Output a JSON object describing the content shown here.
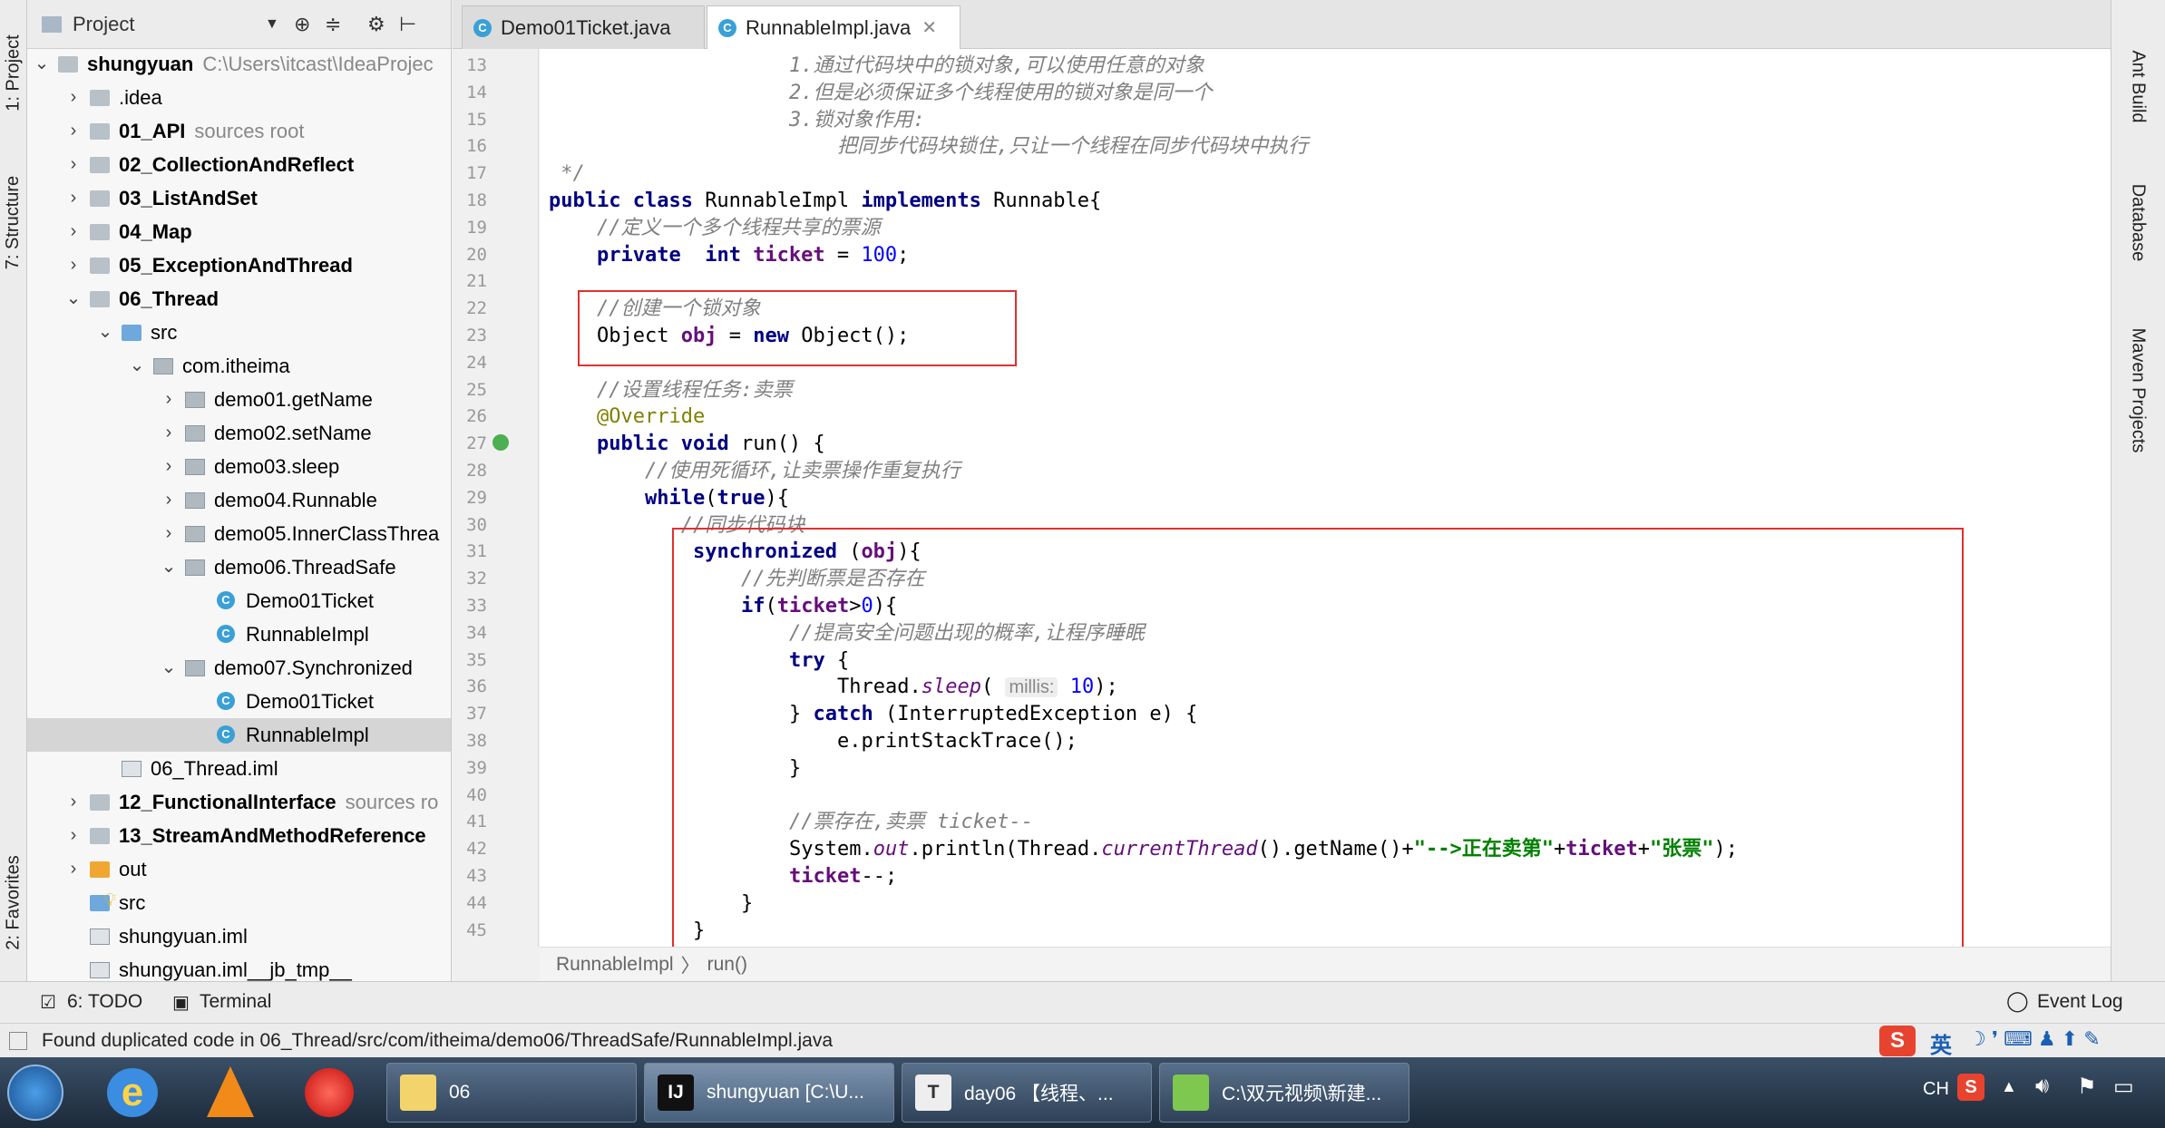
{
  "left_strip": {
    "project_tab": "1: Project",
    "structure_tab": "7: Structure",
    "favorites_tab": "2: Favorites"
  },
  "project_header": {
    "title": "Project"
  },
  "tree": [
    {
      "label": "shungyuan",
      "suffix": "C:\\Users\\itcast\\IdeaProjec",
      "depth": 0,
      "arrow": "v",
      "icon": "folder-grey",
      "bold": true
    },
    {
      "label": ".idea",
      "suffix": "",
      "depth": 1,
      "arrow": ">",
      "icon": "folder-grey",
      "bold": false
    },
    {
      "label": "01_API",
      "suffix": "sources root",
      "depth": 1,
      "arrow": ">",
      "icon": "folder-grey",
      "bold": true
    },
    {
      "label": "02_CollectionAndReflect",
      "suffix": "",
      "depth": 1,
      "arrow": ">",
      "icon": "folder-grey",
      "bold": true
    },
    {
      "label": "03_ListAndSet",
      "suffix": "",
      "depth": 1,
      "arrow": ">",
      "icon": "folder-grey",
      "bold": true
    },
    {
      "label": "04_Map",
      "suffix": "",
      "depth": 1,
      "arrow": ">",
      "icon": "folder-grey",
      "bold": true
    },
    {
      "label": "05_ExceptionAndThread",
      "suffix": "",
      "depth": 1,
      "arrow": ">",
      "icon": "folder-grey",
      "bold": true
    },
    {
      "label": "06_Thread",
      "suffix": "",
      "depth": 1,
      "arrow": "v",
      "icon": "folder-grey",
      "bold": true
    },
    {
      "label": "src",
      "suffix": "",
      "depth": 2,
      "arrow": "v",
      "icon": "folder-blue",
      "bold": false
    },
    {
      "label": "com.itheima",
      "suffix": "",
      "depth": 3,
      "arrow": "v",
      "icon": "pkg",
      "bold": false
    },
    {
      "label": "demo01.getName",
      "suffix": "",
      "depth": 4,
      "arrow": ">",
      "icon": "pkg",
      "bold": false
    },
    {
      "label": "demo02.setName",
      "suffix": "",
      "depth": 4,
      "arrow": ">",
      "icon": "pkg",
      "bold": false
    },
    {
      "label": "demo03.sleep",
      "suffix": "",
      "depth": 4,
      "arrow": ">",
      "icon": "pkg",
      "bold": false
    },
    {
      "label": "demo04.Runnable",
      "suffix": "",
      "depth": 4,
      "arrow": ">",
      "icon": "pkg",
      "bold": false
    },
    {
      "label": "demo05.InnerClassThrea",
      "suffix": "",
      "depth": 4,
      "arrow": ">",
      "icon": "pkg",
      "bold": false
    },
    {
      "label": "demo06.ThreadSafe",
      "suffix": "",
      "depth": 4,
      "arrow": "v",
      "icon": "pkg",
      "bold": false
    },
    {
      "label": "Demo01Ticket",
      "suffix": "",
      "depth": 5,
      "arrow": "",
      "icon": "cls",
      "bold": false
    },
    {
      "label": "RunnableImpl",
      "suffix": "",
      "depth": 5,
      "arrow": "",
      "icon": "cls",
      "bold": false
    },
    {
      "label": "demo07.Synchronized",
      "suffix": "",
      "depth": 4,
      "arrow": "v",
      "icon": "pkg",
      "bold": false
    },
    {
      "label": "Demo01Ticket",
      "suffix": "",
      "depth": 5,
      "arrow": "",
      "icon": "cls",
      "bold": false
    },
    {
      "label": "RunnableImpl",
      "suffix": "",
      "depth": 5,
      "arrow": "",
      "icon": "cls",
      "bold": false,
      "selected": true
    },
    {
      "label": "06_Thread.iml",
      "suffix": "",
      "depth": 2,
      "arrow": "",
      "icon": "file",
      "bold": false
    },
    {
      "label": "12_FunctionalInterface",
      "suffix": "sources ro",
      "depth": 1,
      "arrow": ">",
      "icon": "folder-grey",
      "bold": true
    },
    {
      "label": "13_StreamAndMethodReference",
      "suffix": "",
      "depth": 1,
      "arrow": ">",
      "icon": "folder-grey",
      "bold": true
    },
    {
      "label": "out",
      "suffix": "",
      "depth": 1,
      "arrow": ">",
      "icon": "folder-orange",
      "bold": false
    },
    {
      "label": "src",
      "suffix": "",
      "depth": 1,
      "arrow": "",
      "icon": "folder-blue",
      "bold": false
    },
    {
      "label": "shungyuan.iml",
      "suffix": "",
      "depth": 1,
      "arrow": "",
      "icon": "file",
      "bold": false
    },
    {
      "label": "shungyuan.iml__jb_tmp__",
      "suffix": "",
      "depth": 1,
      "arrow": "",
      "icon": "file",
      "bold": false
    }
  ],
  "tabs": [
    {
      "label": "Demo01Ticket.java",
      "active": false
    },
    {
      "label": "RunnableImpl.java",
      "active": true
    }
  ],
  "code_lines": [
    {
      "n": "13",
      "indent": 20,
      "parts": [
        {
          "t": "1.通过代码块中的锁对象,可以使用任意的对象",
          "c": "cm"
        }
      ]
    },
    {
      "n": "14",
      "indent": 20,
      "parts": [
        {
          "t": "2.但是必须保证多个线程使用的锁对象是同一个",
          "c": "cm"
        }
      ]
    },
    {
      "n": "15",
      "indent": 20,
      "parts": [
        {
          "t": "3.锁对象作用:",
          "c": "cm"
        }
      ]
    },
    {
      "n": "16",
      "indent": 24,
      "parts": [
        {
          "t": "把同步代码块锁住,只让一个线程在同步代码块中执行",
          "c": "cm"
        }
      ]
    },
    {
      "n": "17",
      "indent": 1,
      "parts": [
        {
          "t": "*/",
          "c": "cm"
        }
      ]
    },
    {
      "n": "18",
      "indent": 0,
      "parts": [
        {
          "t": "public class ",
          "c": "kw"
        },
        {
          "t": "RunnableImpl ",
          "c": ""
        },
        {
          "t": "implements ",
          "c": "kw"
        },
        {
          "t": "Runnable{",
          "c": ""
        }
      ]
    },
    {
      "n": "19",
      "indent": 4,
      "parts": [
        {
          "t": "//定义一个多个线程共享的票源",
          "c": "cn"
        }
      ]
    },
    {
      "n": "20",
      "indent": 4,
      "parts": [
        {
          "t": "private  int ",
          "c": "kw"
        },
        {
          "t": "ticket",
          "c": "fld"
        },
        {
          "t": " = ",
          "c": ""
        },
        {
          "t": "100",
          "c": "num"
        },
        {
          "t": ";",
          "c": ""
        }
      ]
    },
    {
      "n": "21",
      "indent": 0,
      "parts": []
    },
    {
      "n": "22",
      "indent": 4,
      "parts": [
        {
          "t": "//创建一个锁对象",
          "c": "cn"
        }
      ]
    },
    {
      "n": "23",
      "indent": 4,
      "parts": [
        {
          "t": "Object ",
          "c": ""
        },
        {
          "t": "obj",
          "c": "fld"
        },
        {
          "t": " = ",
          "c": ""
        },
        {
          "t": "new ",
          "c": "kw"
        },
        {
          "t": "Object();",
          "c": ""
        }
      ]
    },
    {
      "n": "24",
      "indent": 0,
      "parts": []
    },
    {
      "n": "25",
      "indent": 4,
      "parts": [
        {
          "t": "//设置线程任务:卖票",
          "c": "cn"
        }
      ]
    },
    {
      "n": "26",
      "indent": 4,
      "parts": [
        {
          "t": "@Override",
          "c": "ann"
        }
      ]
    },
    {
      "n": "27",
      "indent": 4,
      "parts": [
        {
          "t": "public void ",
          "c": "kw"
        },
        {
          "t": "run() {",
          "c": ""
        }
      ]
    },
    {
      "n": "28",
      "indent": 8,
      "parts": [
        {
          "t": "//使用死循环,让卖票操作重复执行",
          "c": "cn"
        }
      ]
    },
    {
      "n": "29",
      "indent": 8,
      "parts": [
        {
          "t": "while",
          "c": "kw"
        },
        {
          "t": "(",
          "c": ""
        },
        {
          "t": "true",
          "c": "kw"
        },
        {
          "t": "){",
          "c": ""
        }
      ]
    },
    {
      "n": "30",
      "indent": 11,
      "parts": [
        {
          "t": "//同步代码块",
          "c": "cn"
        }
      ]
    },
    {
      "n": "31",
      "indent": 12,
      "parts": [
        {
          "t": "synchronized ",
          "c": "kw"
        },
        {
          "t": "(",
          "c": ""
        },
        {
          "t": "obj",
          "c": "fld"
        },
        {
          "t": "){",
          "c": ""
        }
      ]
    },
    {
      "n": "32",
      "indent": 16,
      "parts": [
        {
          "t": "//先判断票是否存在",
          "c": "cn"
        }
      ]
    },
    {
      "n": "33",
      "indent": 16,
      "parts": [
        {
          "t": "if",
          "c": "kw"
        },
        {
          "t": "(",
          "c": ""
        },
        {
          "t": "ticket",
          "c": "fld"
        },
        {
          "t": ">",
          "c": ""
        },
        {
          "t": "0",
          "c": "num"
        },
        {
          "t": "){",
          "c": ""
        }
      ]
    },
    {
      "n": "34",
      "indent": 20,
      "parts": [
        {
          "t": "//提高安全问题出现的概率,让程序睡眠",
          "c": "cn"
        }
      ]
    },
    {
      "n": "35",
      "indent": 20,
      "parts": [
        {
          "t": "try ",
          "c": "kw"
        },
        {
          "t": "{",
          "c": ""
        }
      ]
    },
    {
      "n": "36",
      "indent": 24,
      "parts": [
        {
          "t": "Thread.",
          "c": ""
        },
        {
          "t": "sleep",
          "c": "sfld"
        },
        {
          "t": "( ",
          "c": ""
        },
        {
          "t": "millis:",
          "c": "hint"
        },
        {
          "t": " ",
          "c": ""
        },
        {
          "t": "10",
          "c": "num"
        },
        {
          "t": ");",
          "c": ""
        }
      ]
    },
    {
      "n": "37",
      "indent": 20,
      "parts": [
        {
          "t": "} ",
          "c": ""
        },
        {
          "t": "catch ",
          "c": "kw"
        },
        {
          "t": "(InterruptedException e) {",
          "c": ""
        }
      ]
    },
    {
      "n": "38",
      "indent": 24,
      "parts": [
        {
          "t": "e.printStackTrace();",
          "c": ""
        }
      ]
    },
    {
      "n": "39",
      "indent": 20,
      "parts": [
        {
          "t": "}",
          "c": ""
        }
      ]
    },
    {
      "n": "40",
      "indent": 0,
      "parts": []
    },
    {
      "n": "41",
      "indent": 20,
      "parts": [
        {
          "t": "//票存在,卖票 ",
          "c": "cn"
        },
        {
          "t": "ticket--",
          "c": "cn"
        }
      ]
    },
    {
      "n": "42",
      "indent": 20,
      "parts": [
        {
          "t": "System.",
          "c": ""
        },
        {
          "t": "out",
          "c": "sfld"
        },
        {
          "t": ".println(Thread.",
          "c": ""
        },
        {
          "t": "currentThread",
          "c": "sfld"
        },
        {
          "t": "().getName()+",
          "c": ""
        },
        {
          "t": "\"-->正在卖第\"",
          "c": "str"
        },
        {
          "t": "+",
          "c": ""
        },
        {
          "t": "ticket",
          "c": "fld"
        },
        {
          "t": "+",
          "c": ""
        },
        {
          "t": "\"张票\"",
          "c": "str"
        },
        {
          "t": ");",
          "c": ""
        }
      ]
    },
    {
      "n": "43",
      "indent": 20,
      "parts": [
        {
          "t": "ticket",
          "c": "fld"
        },
        {
          "t": "--;",
          "c": ""
        }
      ]
    },
    {
      "n": "44",
      "indent": 16,
      "parts": [
        {
          "t": "}",
          "c": ""
        }
      ]
    },
    {
      "n": "45",
      "indent": 12,
      "parts": [
        {
          "t": "}",
          "c": ""
        }
      ]
    }
  ],
  "breadcrumb": {
    "class_name": "RunnableImpl",
    "sep": "〉",
    "method": "run()"
  },
  "right_strip": {
    "ant": "Ant Build",
    "database": "Database",
    "maven": "Maven Projects"
  },
  "tool_bar": {
    "todo": "6: TODO",
    "terminal": "Terminal",
    "event_log": "Event Log"
  },
  "status": {
    "message": "Found duplicated code in 06_Thread/src/com/itheima/demo06/ThreadSafe/RunnableImpl.java"
  },
  "taskbar": {
    "buttons": [
      {
        "label": "06"
      },
      {
        "label": "shungyuan [C:\\U..."
      },
      {
        "label": "day06 【线程、..."
      },
      {
        "label": "C:\\双元视频\\新建..."
      }
    ],
    "lang": "CH",
    "ime": "英"
  }
}
